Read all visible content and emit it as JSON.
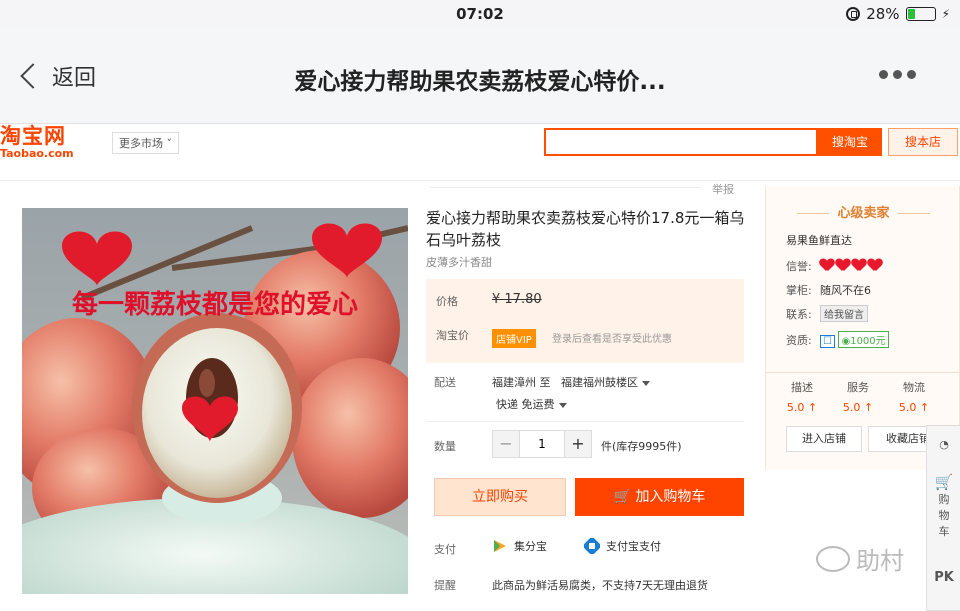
{
  "status": {
    "time": "07:02",
    "battery": "28%",
    "battery_level": 0.28
  },
  "nav": {
    "back_label": "返回",
    "title": "爱心接力帮助果农卖荔枝爱心特价..."
  },
  "taobao": {
    "logo_cn": "淘宝网",
    "logo_en": "Taobao.com",
    "more_markets": "更多市场",
    "search_value": "",
    "search_btn": "搜淘宝",
    "search_store_btn": "搜本店"
  },
  "product": {
    "report": "举报",
    "title": "爱心接力帮助果农卖荔枝爱心特价17.8元一箱乌石乌叶荔枝",
    "subtitle": "皮薄多汁香甜",
    "photo_caption": "每一颗荔枝都是您的爱心",
    "price_label": "价格",
    "price": "¥ 17.80",
    "tb_price_label": "淘宝价",
    "vip_badge": "店铺VIP",
    "vip_hint": "登录后查看是否享受此优惠",
    "ship_label": "配送",
    "ship_from": "福建漳州 至",
    "ship_to": "福建福州鼓楼区",
    "ship_method": "快递 免运费",
    "qty_label": "数量",
    "qty_minus": "−",
    "qty_plus": "+",
    "qty_value": "1",
    "stock": "件(库存9995件)",
    "buy_now": "立即购买",
    "add_cart": "加入购物车",
    "pay_label": "支付",
    "pay_1": "集分宝",
    "pay_2": "支付宝支付",
    "note_label": "提醒",
    "note": "此商品为鲜活易腐类，不支持7天无理由退货"
  },
  "seller": {
    "header": "心级卖家",
    "name": "易果鱼鲜直达",
    "credit_label": "信誉:",
    "hearts": 4,
    "keeper_label": "掌柜:",
    "keeper": "随风不在6",
    "contact_label": "联系:",
    "contact_btn": "给我留言",
    "qual_label": "资质:",
    "qual_badge": "1000元",
    "scores": [
      {
        "label": "描述",
        "value": "5.0 ↑"
      },
      {
        "label": "服务",
        "value": "5.0 ↑"
      },
      {
        "label": "物流",
        "value": "5.0 ↑"
      }
    ],
    "enter_store": "进入店铺",
    "fav_store": "收藏店铺"
  },
  "sidetool": {
    "cart_label": "购物车",
    "pk": "PK"
  },
  "watermark": "助村"
}
